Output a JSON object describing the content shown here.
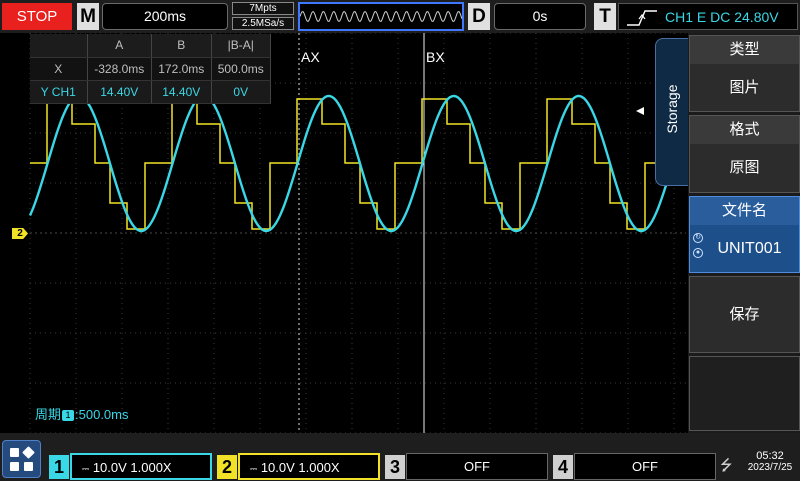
{
  "top": {
    "status": "STOP",
    "m_key": "M",
    "timebase": "200ms",
    "memory_depth": "7Mpts",
    "sample_rate": "2.5MSa/s",
    "d_key": "D",
    "delay": "0s",
    "t_key": "T",
    "trigger": "CH1 E DC 24.80V"
  },
  "measure": {
    "headers": [
      "A",
      "B",
      "|B-A|"
    ],
    "x_label": "X",
    "x_values": [
      "-328.0ms",
      "172.0ms",
      "500.0ms"
    ],
    "y_label": "Y CH1",
    "y_values": [
      "14.40V",
      "14.40V",
      "0V"
    ]
  },
  "cursors": {
    "a_label": "AX",
    "b_label": "BX"
  },
  "ch2_marker": "2",
  "period": {
    "label": "周期",
    "badge": "1",
    "value": ":500.0ms"
  },
  "storage": {
    "tab": "Storage",
    "type_title": "类型",
    "type_value": "图片",
    "format_title": "格式",
    "format_value": "原图",
    "filename_title": "文件名",
    "filename_value": "UNIT001",
    "save_label": "保存"
  },
  "channels": [
    {
      "num": "1",
      "setting": "10.0V 1.000X"
    },
    {
      "num": "2",
      "setting": "10.0V 1.000X"
    },
    {
      "num": "3",
      "setting": "OFF"
    },
    {
      "num": "4",
      "setting": "OFF"
    }
  ],
  "clock": {
    "time": "05:32",
    "date": "2023/7/25"
  },
  "colors": {
    "ch1": "#3ad7e6",
    "ch2": "#f2e227",
    "stop": "#e8201e",
    "accent": "#3f78ff"
  }
}
